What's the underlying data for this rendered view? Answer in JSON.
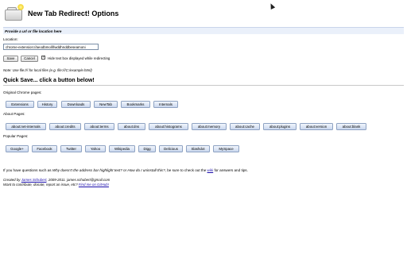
{
  "header": {
    "title": "New Tab Redirect! Options",
    "logo_icon": "new-tab-star-icon"
  },
  "section": {
    "heading": "Provide a url or file location here"
  },
  "location": {
    "label": "Location:",
    "value": "chrome-extension://aeodbmoififwddhnddbeseamoni"
  },
  "actions": {
    "save_label": "Save",
    "cancel_label": "Cancel"
  },
  "hide_text": {
    "label": "Hide text box displayed while redirecting",
    "checked": true
  },
  "note": "Note: Use file:/// for local files (e.g. file:///C:/example.html)",
  "quick_save": {
    "title": "Quick Save... click a button below!",
    "groups": [
      {
        "label": "Original Chrome pages:",
        "buttons": [
          "Extensions",
          "History",
          "Downloads",
          "NewTab",
          "Bookmarks",
          "Internals"
        ]
      },
      {
        "label": "About Pages:",
        "buttons": [
          "about:net-internals",
          "about:credits",
          "about:terms",
          "about:dns",
          "about:histograms",
          "about:memory",
          "about:cache",
          "about:plugins",
          "about:version",
          "about:blank"
        ]
      },
      {
        "label": "Popular Pages:",
        "buttons": [
          "Google+",
          "Facebook",
          "Twitter",
          "Yahoo",
          "Wikipedia",
          "Digg",
          "Delicious",
          "Slashdot",
          "MySpace"
        ]
      }
    ]
  },
  "footer": {
    "question_prefix": "If you have questions such as ",
    "question_q1": "Why doesn't the address bar highlight text?",
    "question_or": " or ",
    "question_q2": "How do I uninstall this?",
    "question_mid": ", be sure to check out the ",
    "wiki_link": "wiki",
    "question_suffix": " for answers and tips.",
    "created_prefix": "Created by ",
    "author_link": "James Schubert",
    "created_suffix": ", 2009-2011. james.schubert@gmail.com",
    "contribute_prefix": "Want to contribute, donate, report an issue, etc? ",
    "github_link": "Find me on GitHub!"
  }
}
